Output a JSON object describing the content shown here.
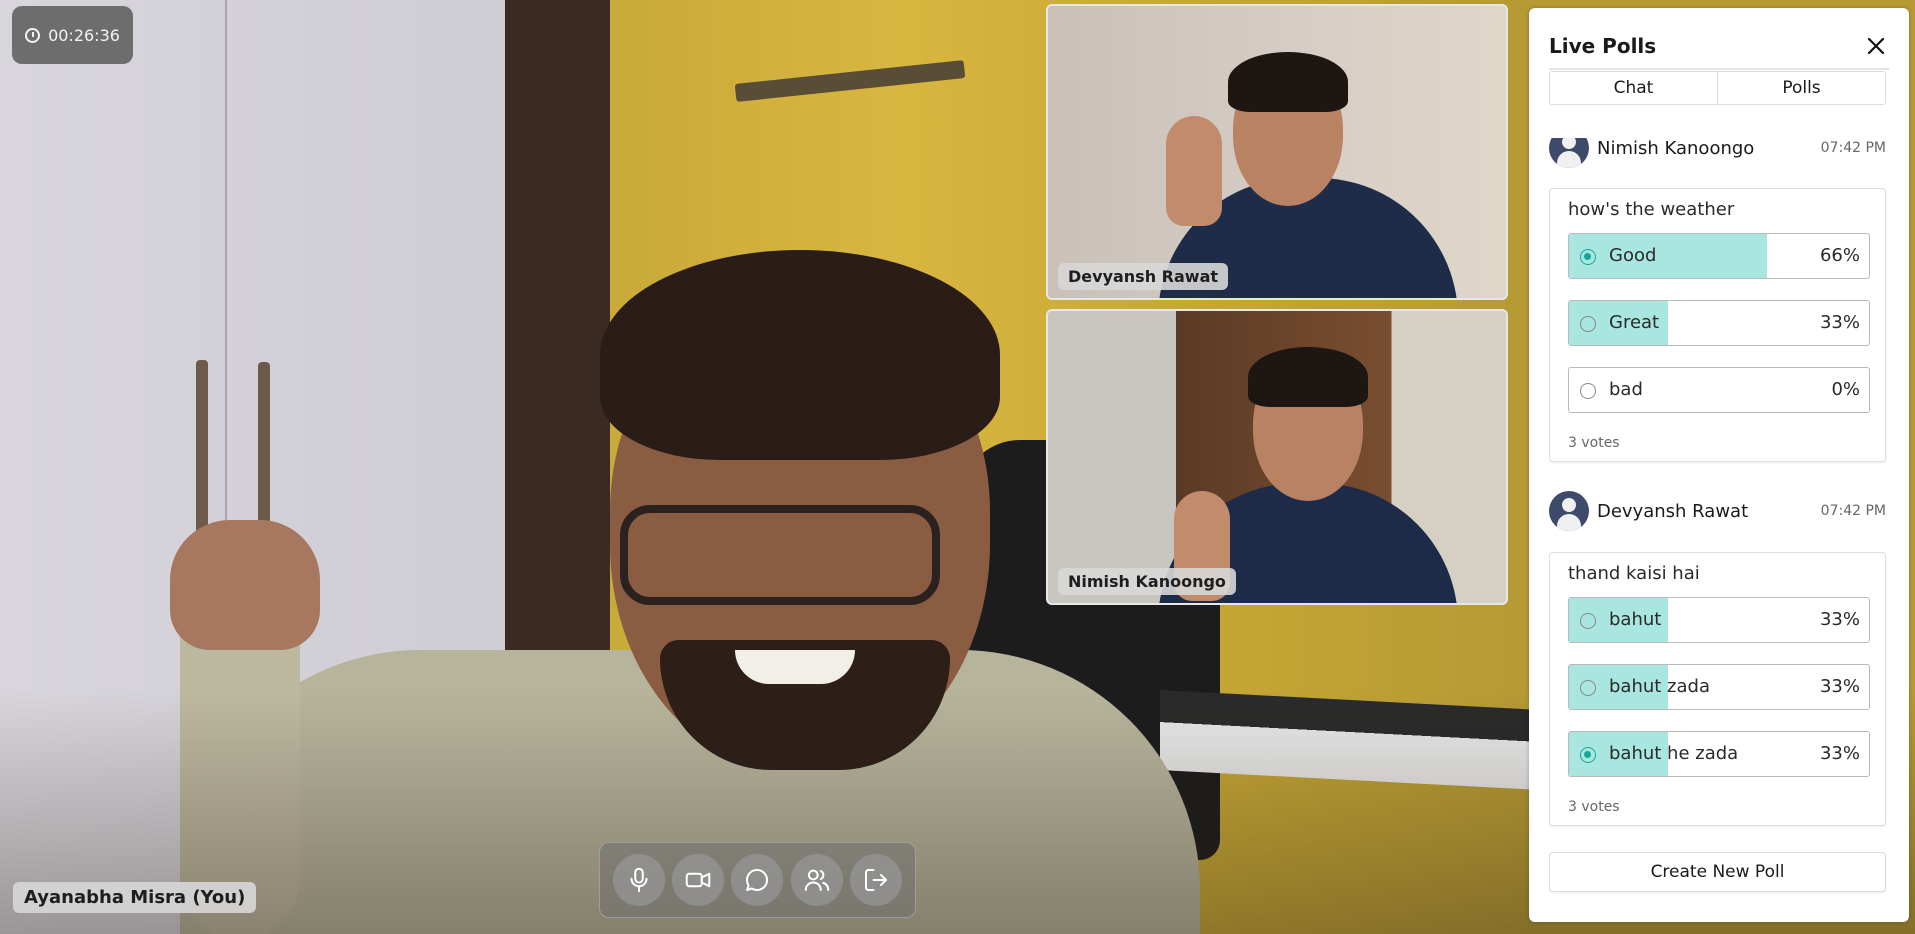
{
  "timer": {
    "elapsed": "00:26:36"
  },
  "self_name": "Ayanabha Misra (You)",
  "participants": [
    {
      "name": "Devyansh Rawat"
    },
    {
      "name": "Nimish Kanoongo"
    }
  ],
  "controls": [
    {
      "name": "microphone-icon"
    },
    {
      "name": "camera-icon"
    },
    {
      "name": "chat-icon"
    },
    {
      "name": "participants-icon"
    },
    {
      "name": "leave-icon"
    }
  ],
  "panel": {
    "title": "Live Polls",
    "tabs": [
      "Chat",
      "Polls"
    ],
    "create_label": "Create New Poll"
  },
  "polls": [
    {
      "author": "Nimish Kanoongo",
      "time": "07:42 PM",
      "question": "how's the weather",
      "options": [
        {
          "label": "Good",
          "percent": "66%",
          "fraction": 0.66,
          "selected": true
        },
        {
          "label": "Great",
          "percent": "33%",
          "fraction": 0.33,
          "selected": false
        },
        {
          "label": "bad",
          "percent": "0%",
          "fraction": 0,
          "selected": false
        }
      ],
      "votes": "3 votes"
    },
    {
      "author": "Devyansh Rawat",
      "time": "07:42 PM",
      "question": "thand kaisi hai",
      "options": [
        {
          "label": "bahut",
          "percent": "33%",
          "fraction": 0.33,
          "selected": false
        },
        {
          "label": "bahut zada",
          "percent": "33%",
          "fraction": 0.33,
          "selected": false
        },
        {
          "label": "bahut he zada",
          "percent": "33%",
          "fraction": 0.33,
          "selected": true
        }
      ],
      "votes": "3 votes"
    }
  ],
  "colors": {
    "accent": "#19a596",
    "poll_fill": "#a8e6df"
  }
}
